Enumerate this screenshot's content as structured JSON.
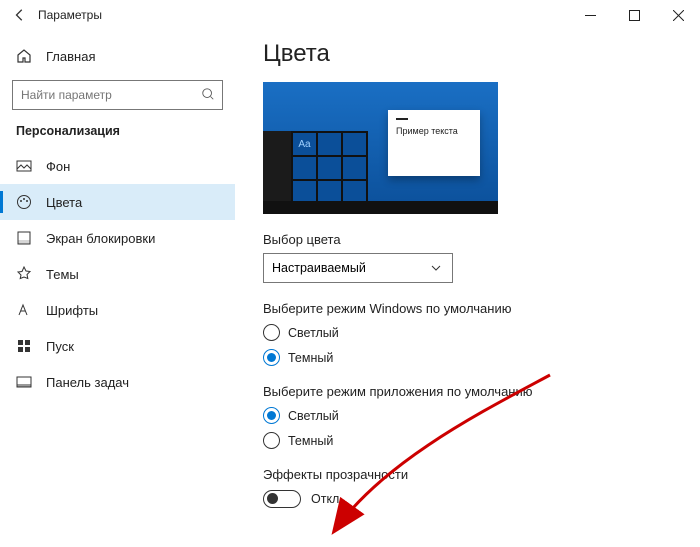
{
  "window": {
    "title": "Параметры"
  },
  "sidebar": {
    "home": "Главная",
    "search_placeholder": "Найти параметр",
    "section": "Персонализация",
    "items": [
      {
        "label": "Фон"
      },
      {
        "label": "Цвета"
      },
      {
        "label": "Экран блокировки"
      },
      {
        "label": "Темы"
      },
      {
        "label": "Шрифты"
      },
      {
        "label": "Пуск"
      },
      {
        "label": "Панель задач"
      }
    ],
    "active_index": 1
  },
  "main": {
    "heading": "Цвета",
    "preview_sample_text": "Пример текста",
    "preview_aa": "Aa",
    "color_choice_label": "Выбор цвета",
    "color_choice_value": "Настраиваемый",
    "windows_mode_label": "Выберите режим Windows по умолчанию",
    "windows_mode_options": {
      "light": "Светлый",
      "dark": "Темный"
    },
    "windows_mode_selected": "dark",
    "app_mode_label": "Выберите режим приложения по умолчанию",
    "app_mode_options": {
      "light": "Светлый",
      "dark": "Темный"
    },
    "app_mode_selected": "light",
    "transparency_label": "Эффекты прозрачности",
    "transparency_state": "Откл."
  }
}
